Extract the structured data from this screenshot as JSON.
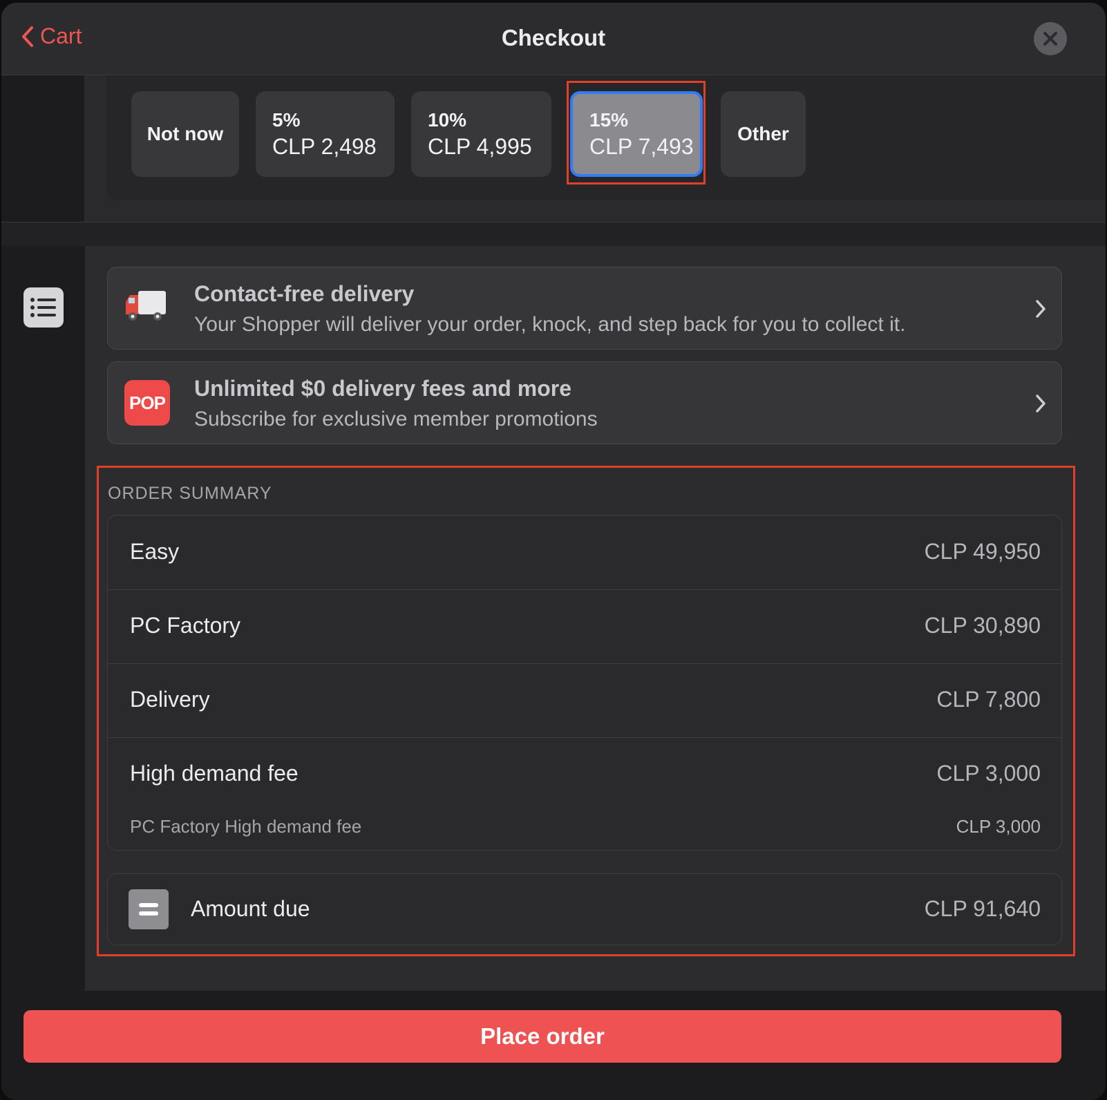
{
  "header": {
    "back_label": "Cart",
    "title": "Checkout"
  },
  "tips": {
    "options": [
      {
        "label": "Not now"
      },
      {
        "pct": "5%",
        "amount": "CLP 2,498"
      },
      {
        "pct": "10%",
        "amount": "CLP 4,995"
      },
      {
        "pct": "15%",
        "amount": "CLP 7,493"
      },
      {
        "label": "Other"
      }
    ],
    "selected_index": 3
  },
  "cards": {
    "contact_free": {
      "title": "Contact-free delivery",
      "subtitle": "Your Shopper will deliver your order, knock, and step back for you to collect it."
    },
    "membership": {
      "icon_text": "POP",
      "title": "Unlimited $0 delivery fees and more",
      "subtitle": "Subscribe for exclusive member promotions"
    }
  },
  "summary": {
    "label": "ORDER SUMMARY",
    "rows": [
      {
        "label": "Easy",
        "value": "CLP 49,950"
      },
      {
        "label": "PC Factory",
        "value": "CLP 30,890"
      },
      {
        "label": "Delivery",
        "value": "CLP 7,800"
      },
      {
        "label": "High demand fee",
        "value": "CLP 3,000"
      }
    ],
    "sub_row": {
      "label": "PC Factory High demand fee",
      "value": "CLP 3,000"
    },
    "total": {
      "label": "Amount due",
      "value": "CLP 91,640"
    }
  },
  "footer": {
    "place_order_label": "Place order"
  },
  "colors": {
    "accent": "#ee5253",
    "selected_border": "#2f7cf6",
    "highlight": "#e0402a"
  }
}
